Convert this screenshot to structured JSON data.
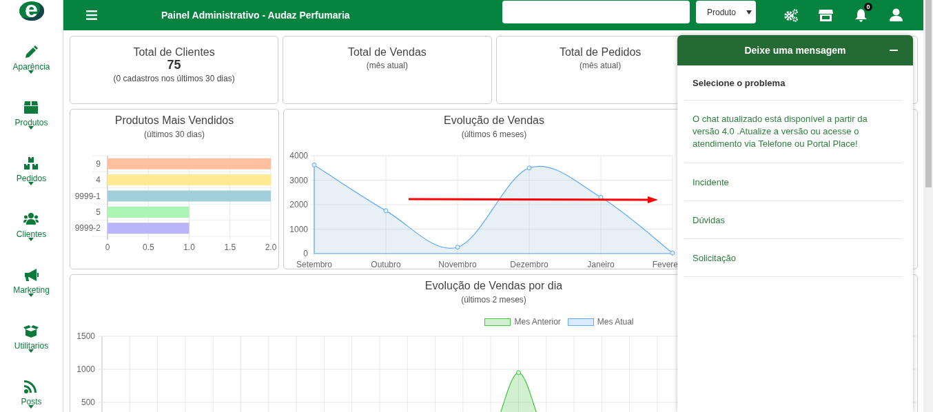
{
  "logo": {
    "letter": "e"
  },
  "sidebar": {
    "items": [
      {
        "label": "Aparência",
        "kind": "pencil"
      },
      {
        "label": "Produtos",
        "kind": "box"
      },
      {
        "label": "Pedidos",
        "kind": "boxes"
      },
      {
        "label": "Clientes",
        "kind": "users"
      },
      {
        "label": "Marketing",
        "kind": "megaphone"
      },
      {
        "label": "Utilitarios",
        "kind": "openbox"
      },
      {
        "label": "Posts",
        "kind": "rss"
      }
    ]
  },
  "topbar": {
    "title": "Painel Administrativo - Audaz Perfumaria",
    "select": {
      "value": "Produto"
    },
    "notifications": {
      "badge": "0"
    }
  },
  "stats": [
    {
      "title": "Total de Clientes",
      "value": "75",
      "subtitle": "(0 cadastros nos últimos 30 dias)"
    },
    {
      "title": "Total de Vendas",
      "subtitle": "(mês atual)"
    },
    {
      "title": "Total de Pedidos",
      "subtitle": "(mês atual)"
    }
  ],
  "top_products": {
    "title": "Produtos Mais Vendidos",
    "subtitle": "(últimos 30 dias)",
    "chart_data": {
      "type": "bar",
      "orientation": "horizontal",
      "categories": [
        "9",
        "4",
        "9999-1",
        "5",
        "9999-2"
      ],
      "grid": true,
      "series": [
        {
          "values": [
            2,
            2,
            2,
            1,
            1
          ]
        }
      ],
      "colors": [
        "#ffc09f",
        "#ffea94",
        "#a0ceda",
        "#abf5b4",
        "#b9b5fb"
      ],
      "xlim": [
        0,
        2
      ],
      "xticks": [
        0,
        {
          "value": 0.5,
          "label": "0.5"
        },
        {
          "value": 1,
          "label": "1.0"
        },
        {
          "value": 1.5,
          "label": "1.5"
        },
        {
          "value": 2,
          "label": "2.0"
        }
      ]
    }
  },
  "sales_trend": {
    "title": "Evolução de Vendas",
    "subtitle": "(últimos 6 meses)",
    "chart_data": {
      "type": "area",
      "categories": [
        "Setembro",
        "Outubro",
        "Novembro",
        "Dezembro",
        "Janeiro",
        "Fevere"
      ],
      "grid": true,
      "series": [
        {
          "color": "#5ea8f7",
          "values": [
            3620,
            1750,
            260,
            3500,
            2300,
            20
          ]
        }
      ],
      "ylim": [
        0,
        4000
      ],
      "yticks": [
        0,
        1000,
        2000,
        3000,
        4000
      ]
    }
  },
  "daily_sales": {
    "title": "Evolução de Vendas por dia",
    "subtitle": "(últimos 2 meses)",
    "chart_data": {
      "type": "area",
      "grid": true,
      "series": [
        {
          "name": "Mes Anterior",
          "color": "#44c444",
          "values": [
            0,
            0,
            0,
            0,
            0,
            0,
            0,
            0,
            0,
            0,
            0,
            0,
            0,
            0,
            0,
            950,
            0,
            0,
            0,
            0,
            0,
            0
          ]
        },
        {
          "name": "Mes Atual",
          "color": "#66aaf7"
        }
      ],
      "ylim": [
        0,
        1500
      ],
      "yticks": [
        500,
        1000,
        1500
      ]
    }
  },
  "chat": {
    "title": "Deixe uma mensagem",
    "prompt": "Selecione o problema",
    "notice": "O chat atualizado está disponível a partir da versão 4.0 .Atualize a versão ou acesse o atendimento via Telefone ou Portal Place!",
    "options": [
      "Incidente",
      "Dúvidas",
      "Solicitação"
    ]
  }
}
